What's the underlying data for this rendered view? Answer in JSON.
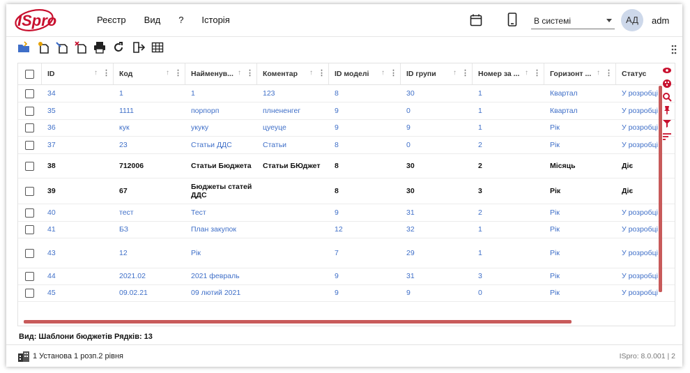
{
  "app": {
    "logo_text": "ISpro"
  },
  "menu": [
    "Реєстр",
    "Вид",
    "?",
    "Історія"
  ],
  "header": {
    "system_select": "В системі",
    "avatar_initials": "АД",
    "user": "adm"
  },
  "toolbar": {
    "icons": [
      "open-folder-icon",
      "add-document-icon",
      "edit-document-icon",
      "delete-document-icon",
      "print-icon",
      "refresh-icon",
      "export-icon",
      "table-icon"
    ]
  },
  "grid": {
    "columns": [
      {
        "label": "ID"
      },
      {
        "label": "Код"
      },
      {
        "label": "Найменув..."
      },
      {
        "label": "Коментар"
      },
      {
        "label": "ID моделі"
      },
      {
        "label": "ID групи"
      },
      {
        "label": "Номер за ..."
      },
      {
        "label": "Горизонт ..."
      },
      {
        "label": "Статус"
      }
    ],
    "rows": [
      {
        "id": "34",
        "code": "1",
        "name": "1",
        "comment": "123",
        "model": "8",
        "group": "30",
        "num": "1",
        "horizon": "Квартал",
        "status": "У розробці",
        "bold": false
      },
      {
        "id": "35",
        "code": "1111",
        "name": "порпорп",
        "comment": "плнененгег",
        "model": "9",
        "group": "0",
        "num": "1",
        "horizon": "Квартал",
        "status": "У розробці",
        "bold": false
      },
      {
        "id": "36",
        "code": "кук",
        "name": "укуку",
        "comment": "цуеуце",
        "model": "9",
        "group": "9",
        "num": "1",
        "horizon": "Рік",
        "status": "У розробці",
        "bold": false
      },
      {
        "id": "37",
        "code": "23",
        "name": "Статьи ДДС",
        "comment": "Статьи",
        "model": "8",
        "group": "0",
        "num": "2",
        "horizon": "Рік",
        "status": "У розробці",
        "bold": false
      },
      {
        "id": "38",
        "code": "712006",
        "name": "Статьи Бюджета",
        "comment": "Статьи БЮджет",
        "model": "8",
        "group": "30",
        "num": "2",
        "horizon": "Місяць",
        "status": "Діє",
        "bold": true
      },
      {
        "id": "39",
        "code": "67",
        "name": "Бюджеты статей",
        "name2": "ДДС",
        "comment": "",
        "model": "8",
        "group": "30",
        "num": "3",
        "horizon": "Рік",
        "status": "Діє",
        "bold": true
      },
      {
        "id": "40",
        "code": "тест",
        "name": "Тест",
        "comment": "",
        "model": "9",
        "group": "31",
        "num": "2",
        "horizon": "Рік",
        "status": "У розробці",
        "bold": false
      },
      {
        "id": "41",
        "code": "БЗ",
        "name": "План закупок",
        "comment": "",
        "model": "12",
        "group": "32",
        "num": "1",
        "horizon": "Рік",
        "status": "У розробці",
        "bold": false
      },
      {
        "id": "43",
        "code": "12",
        "name": "Рік",
        "comment": "",
        "model": "7",
        "group": "29",
        "num": "1",
        "horizon": "Рік",
        "status": "У розробці",
        "bold": false
      },
      {
        "id": "44",
        "code": "2021.02",
        "name": "2021 февраль",
        "comment": "",
        "model": "9",
        "group": "31",
        "num": "3",
        "horizon": "Рік",
        "status": "У розробці",
        "bold": false
      },
      {
        "id": "45",
        "code": "09.02.21",
        "name": "09 лютий 2021",
        "comment": "",
        "model": "9",
        "group": "9",
        "num": "0",
        "horizon": "Рік",
        "status": "У розробці",
        "bold": false
      }
    ]
  },
  "status_bar": {
    "text": "Вид: Шаблони бюджетів  Рядків: 13"
  },
  "footer": {
    "org": "1 Установа 1 розп.2 рівня",
    "version": "ISpro: 8.0.001 | 2"
  },
  "colors": {
    "accent": "#c8102e",
    "link": "#3f6fc8",
    "scroll": "#c85a5a"
  }
}
